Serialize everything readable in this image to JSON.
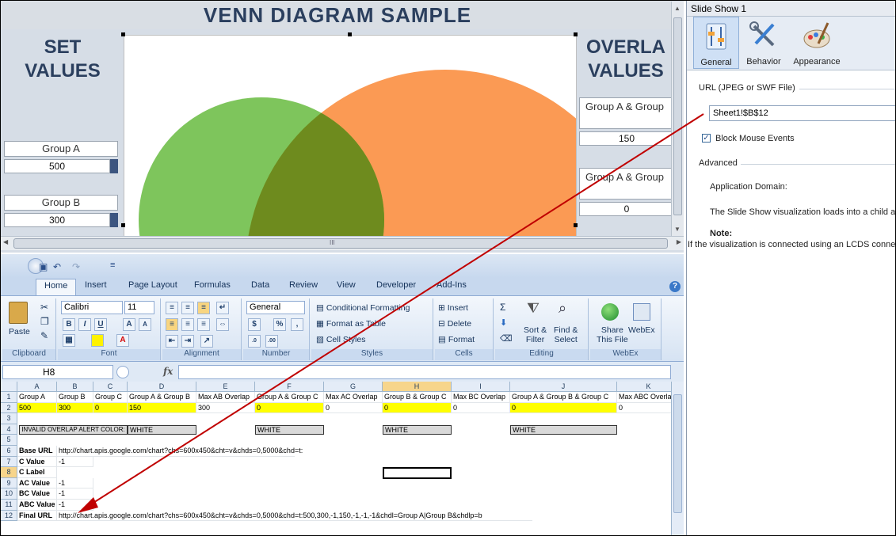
{
  "designer": {
    "title": "VENN DIAGRAM SAMPLE",
    "set_values_title_line1": "SET",
    "set_values_title_line2": "VALUES",
    "overlap_title_line1": "OVERLA",
    "overlap_title_line2": "VALUES",
    "set_a_label": "Group A",
    "set_a_value": "500",
    "set_b_label": "Group B",
    "set_b_value": "300",
    "overlap_ab_label": "Group A & Group",
    "overlap_ab_value": "150",
    "overlap_ac_label": "Group A & Group",
    "overlap_ac_value": "0",
    "scroll_grip": "III",
    "colors": {
      "green_circle": "#6cbd45",
      "orange_circle": "#fb8c3c",
      "title_text": "#2b3f5e"
    }
  },
  "properties": {
    "window_title": "Slide Show 1",
    "tabs": [
      {
        "label": "General",
        "icon": "general-settings-icon",
        "selected": true
      },
      {
        "label": "Behavior",
        "icon": "behavior-tools-icon",
        "selected": false
      },
      {
        "label": "Appearance",
        "icon": "appearance-palette-icon",
        "selected": false
      }
    ],
    "url_section_label": "URL (JPEG or SWF File)",
    "url_value": "Sheet1!$B$12",
    "block_mouse_label": "Block Mouse Events",
    "block_mouse_checked": true,
    "advanced_label": "Advanced",
    "app_domain_label": "Application Domain:",
    "description": "The Slide Show visualization loads into a child applica",
    "note_label": "Note:",
    "note_text": "If the visualization is connected using an LCDS conne"
  },
  "excel": {
    "qat_customize": "≡",
    "ribbon_tabs": [
      "Home",
      "Insert",
      "Page Layout",
      "Formulas",
      "Data",
      "Review",
      "View",
      "Developer",
      "Add-Ins"
    ],
    "groups": {
      "clipboard": {
        "label": "Clipboard",
        "paste": "Paste"
      },
      "font": {
        "label": "Font",
        "font_name": "Calibri",
        "font_size": "11",
        "bold": "B",
        "italic": "I",
        "underline": "U"
      },
      "alignment": {
        "label": "Alignment"
      },
      "number": {
        "label": "Number",
        "format": "General",
        "currency": "$",
        "percent": "%",
        "comma": ","
      },
      "styles": {
        "label": "Styles",
        "conditional": "Conditional Formatting",
        "format_table": "Format as Table",
        "cell_styles": "Cell Styles"
      },
      "cells": {
        "label": "Cells",
        "insert": "Insert",
        "delete": "Delete",
        "format": "Format"
      },
      "editing": {
        "label": "Editing",
        "sort_line1": "Sort &",
        "sort_line2": "Filter",
        "find_line1": "Find &",
        "find_line2": "Select"
      },
      "webex": {
        "label": "WebEx",
        "share_line1": "Share",
        "share_line2": "This File",
        "webex_btn": "WebEx"
      }
    },
    "name_box": "H8",
    "fx": "fx",
    "columns": [
      "A",
      "B",
      "C",
      "D",
      "E",
      "F",
      "G",
      "H",
      "I",
      "J",
      "K"
    ],
    "rows": [
      "1",
      "2",
      "3",
      "4",
      "5",
      "6",
      "7",
      "8",
      "9",
      "10",
      "11",
      "12"
    ],
    "row1": [
      "Group A",
      "Group B",
      "Group C",
      "Group A & Group B",
      "Max AB Overlap",
      "Group A & Group C",
      "Max AC Overlap",
      "Group B & Group C",
      "Max BC Overlap",
      "Group A & Group B & Group C",
      "Max ABC Overla"
    ],
    "row2": [
      "500",
      "300",
      "0",
      "150",
      "300",
      "0",
      "0",
      "0",
      "0",
      "0",
      "0"
    ],
    "row4_label": "INVALID OVERLAP ALERT COLOR:",
    "row4_d": "WHITE",
    "row4_f": "WHITE",
    "row4_h": "WHITE",
    "row4_j": "WHITE",
    "row6_label": "Base URL",
    "row6_value": "http://chart.apis.google.com/chart?chs=600x450&cht=v&chds=0,5000&chd=t:",
    "row7_label": "C Value",
    "row7_value": "-1",
    "row8_label": "C Label",
    "row9_label": "AC Value",
    "row9_value": "-1",
    "row10_label": "BC Value",
    "row10_value": "-1",
    "row11_label": "ABC Value",
    "row11_value": "-1",
    "row12_label": "Final URL",
    "row12_value": "http://chart.apis.google.com/chart?chs=600x450&cht=v&chds=0,5000&chd=t:500,300,-1,150,-1,-1,-1&chdl=Group A|Group B&chdlp=b"
  }
}
